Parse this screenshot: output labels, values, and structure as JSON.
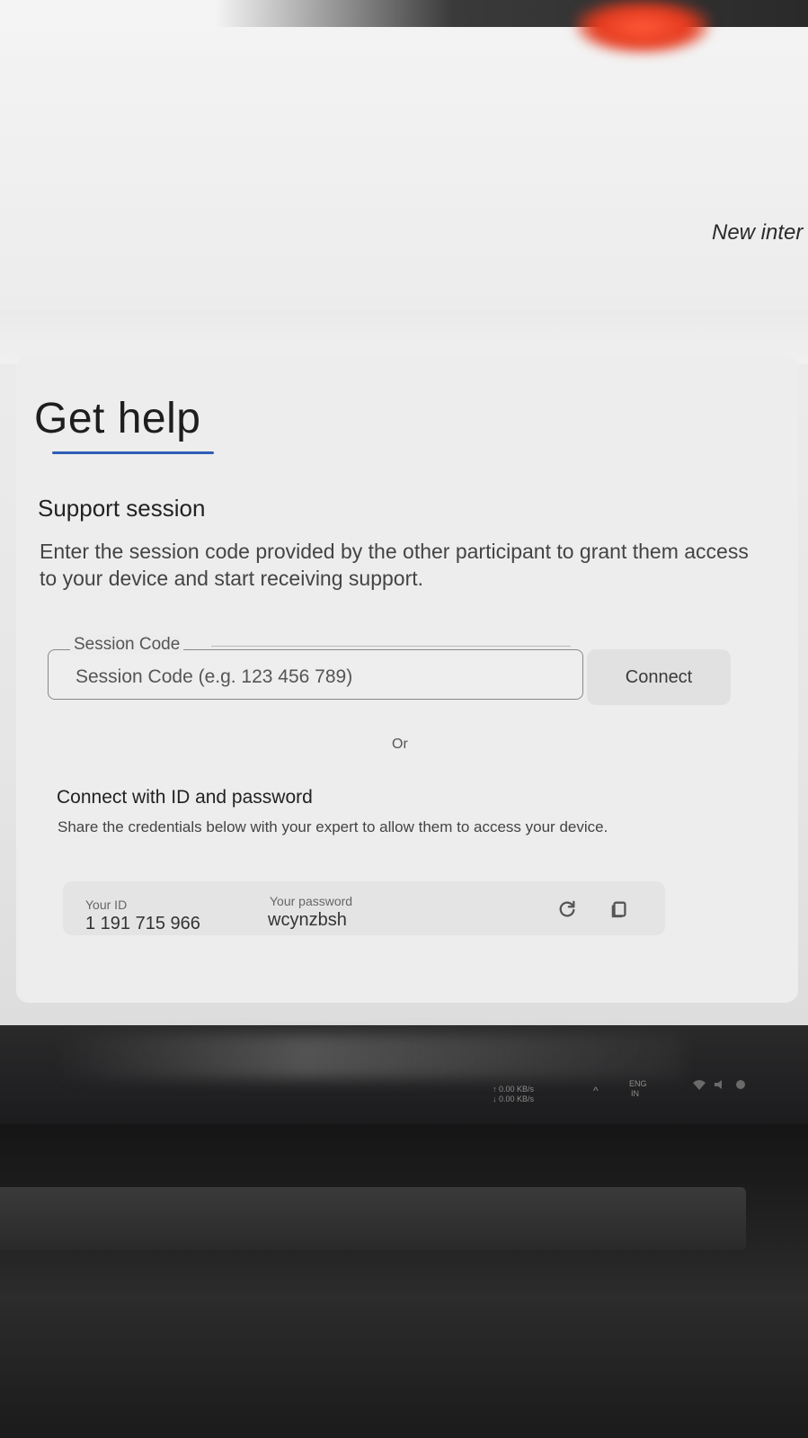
{
  "header": {
    "new_interaction_label": "New inter"
  },
  "page": {
    "title": "Get help",
    "accent_color": "#2f5db8"
  },
  "support_session": {
    "heading": "Support session",
    "description": "Enter the session code provided by the other participant to grant them access to your device and start receiving support.",
    "field_label": "Session Code",
    "placeholder": "Session Code (e.g. 123 456 789)",
    "connect_label": "Connect"
  },
  "divider_label": "Or",
  "id_password": {
    "heading": "Connect with ID and password",
    "description": "Share the credentials below with your expert to allow them to access your device.",
    "id_label": "Your ID",
    "id_value": "1 191 715 966",
    "password_label": "Your password",
    "password_value": "wcynzbsh",
    "refresh_icon": "refresh-icon",
    "copy_icon": "copy-icon"
  },
  "taskbar": {
    "upload_speed": "↑ 0.00 KB/s",
    "download_speed": "↓ 0.00 KB/s",
    "language_line1": "ENG",
    "language_line2": "IN"
  }
}
